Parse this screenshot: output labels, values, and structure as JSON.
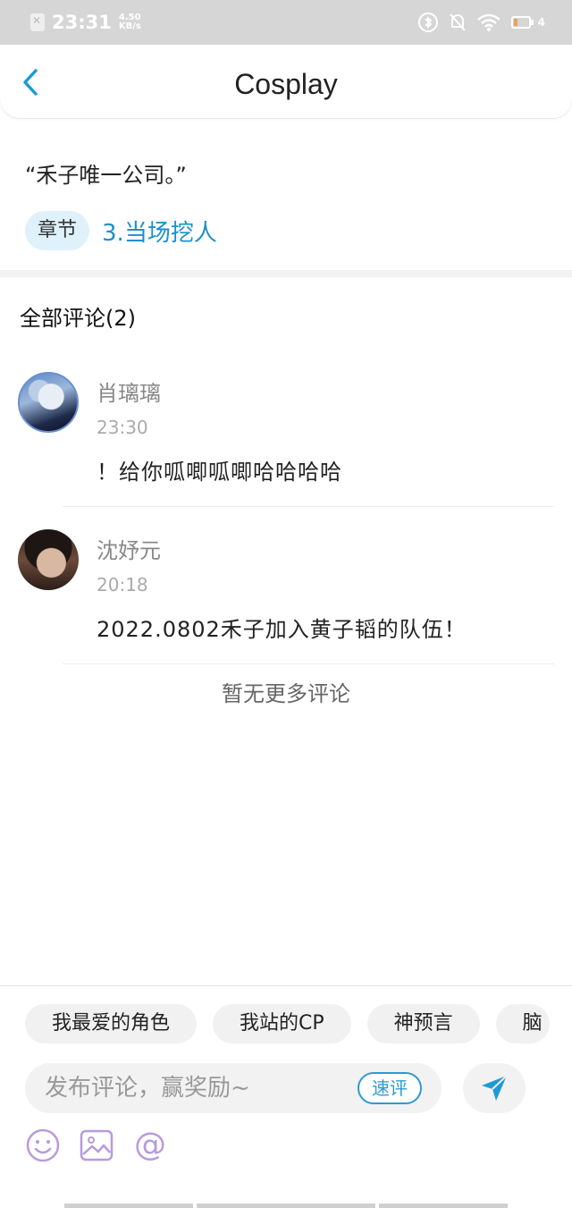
{
  "status_bar": {
    "time": "23:31",
    "speed_value": "4.50",
    "speed_unit": "KB/s",
    "battery_level": "4"
  },
  "header": {
    "title": "Cosplay",
    "back_icon": "chevron-left-icon"
  },
  "quote": "“禾子唯一公司。”",
  "chapter": {
    "tag": "章节",
    "link": "3.当场挖人"
  },
  "comments_section": {
    "title": "全部评论(2)",
    "items": [
      {
        "name": "肖璃璃",
        "time": "23:30",
        "body": "！给你呱唧呱唧哈哈哈哈"
      },
      {
        "name": "沈妤元",
        "time": "20:18",
        "body": "2022.0802禾子加入黄子韬的队伍！"
      }
    ],
    "no_more": "暂无更多评论"
  },
  "bottom": {
    "chips": [
      "我最爱的角色",
      "我站的CP",
      "神预言",
      "脑"
    ],
    "input_placeholder": "发布评论，赢奖励~",
    "quick_comment": "速评",
    "send_icon": "send-icon",
    "tools": [
      "emoji-icon",
      "image-icon",
      "mention-icon"
    ]
  },
  "colors": {
    "accent": "#1b91c9",
    "tag_bg": "#dff1fb",
    "tool_icon": "#b89bdc"
  }
}
